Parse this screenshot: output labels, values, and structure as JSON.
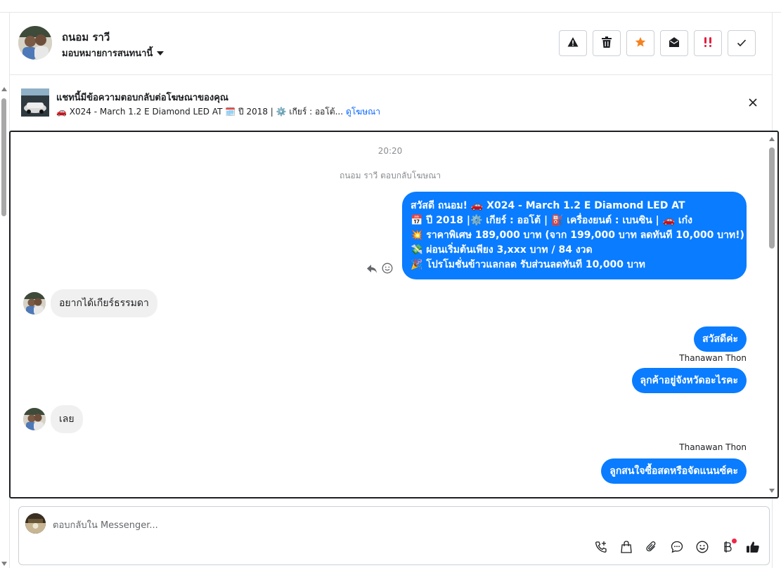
{
  "header": {
    "contact_name": "ถนอม ราวี",
    "assign_label": "มอบหมายการสนทนานี้",
    "actions": [
      {
        "name": "spam-button",
        "icon": "warning-icon"
      },
      {
        "name": "delete-button",
        "icon": "trash-icon"
      },
      {
        "name": "star-button",
        "icon": "star-icon"
      },
      {
        "name": "mark-unread-button",
        "icon": "envelope-open-icon"
      },
      {
        "name": "follow-up-button",
        "icon": "exclamation-icon"
      },
      {
        "name": "mark-done-button",
        "icon": "check-icon"
      }
    ]
  },
  "ad_banner": {
    "title": "แชทนี้มีข้อความตอบกลับต่อโฆษณาของคุณ",
    "subtitle": "🚗 X024 - March 1.2 E Diamond LED AT 🗓️ ปี 2018 | ⚙️ เกียร์ : ออโต้...",
    "link": "ดูโฆษณา"
  },
  "chat": {
    "timestamp": "20:20",
    "system_note": "ถนอม ราวี ตอบกลับโฆษณา",
    "ad_message_lines": [
      "สวัสดี ถนอม! 🚗 X024 - March 1.2 E Diamond LED AT",
      "📅 ปี 2018 |⚙️ เกียร์ : ออโต้ | ⛽ เครื่องยนต์ : เบนซิน | 🚗 เก๋ง",
      "💥 ราคาพิเศษ 189,000 บาท (จาก 199,000 บาท ลดทันที 10,000 บาท!)",
      "💸 ผ่อนเริ่มต้นเพียง 3,xxx บาท / 84 งวด",
      "🎉 โปรโมชั่นข้าวแลกลด รับส่วนลดทันที 10,000 บาท"
    ],
    "messages": {
      "in1": "อยากได้เกียร์ธรรมดา",
      "out1": "สวัสดีค่ะ",
      "sender1": "Thanawan Thon",
      "out2": "ลุกค้าอยู่จังหวัดอะไรคะ",
      "in2": "เลย",
      "sender2": "Thanawan Thon",
      "out3": "ลูกสนใจซื้อสดหรือจัดแนนซ์คะ"
    }
  },
  "composer": {
    "placeholder": "ตอบกลับใน Messenger...",
    "tools": [
      "call-add-icon",
      "shopping-bag-icon",
      "paperclip-icon",
      "chat-bubble-icon",
      "emoji-icon",
      "baht-icon",
      "thumbs-up-icon"
    ]
  },
  "colors": {
    "accent": "#0a7cff",
    "link": "#0866ff",
    "star": "#f5821f",
    "alert": "#e41e3f",
    "notification_dot": "#f02849"
  }
}
